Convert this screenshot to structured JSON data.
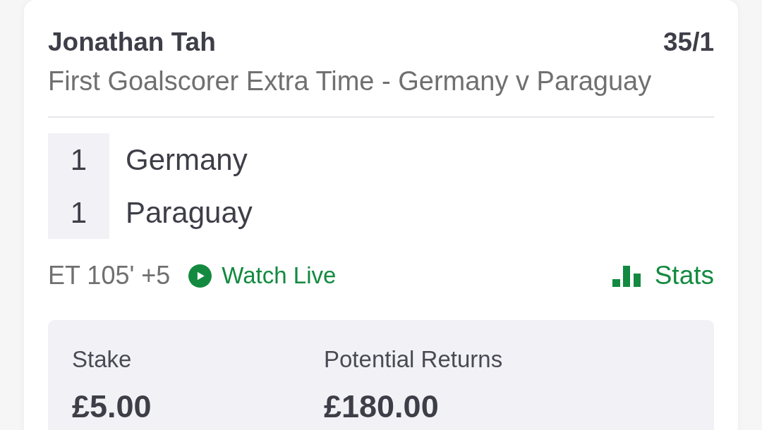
{
  "selection": {
    "name": "Jonathan Tah",
    "odds": "35/1",
    "market": "First Goalscorer Extra Time - Germany v Paraguay"
  },
  "scoreboard": [
    {
      "score": "1",
      "team": "Germany"
    },
    {
      "score": "1",
      "team": "Paraguay"
    }
  ],
  "match_status": {
    "clock": "ET 105' +5",
    "watch_live": "Watch Live",
    "stats": "Stats"
  },
  "bet_summary": [
    {
      "label": "Stake",
      "value": "£5.00"
    },
    {
      "label": "Potential Returns",
      "value": "£180.00"
    }
  ]
}
